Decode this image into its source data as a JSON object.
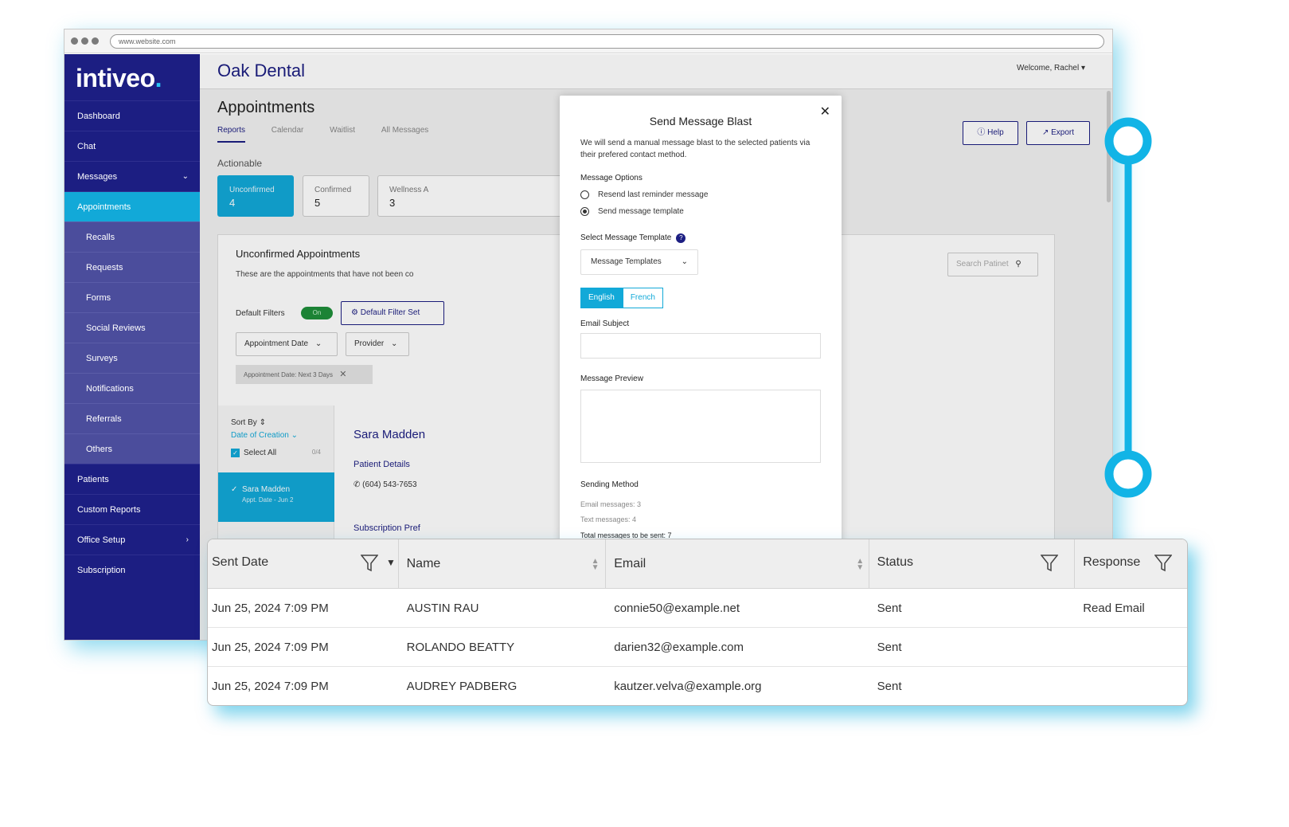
{
  "browser": {
    "url": "www.website.com"
  },
  "brand": {
    "logo_main": "intiveo",
    "logo_dot": ".",
    "accent": "#12a9d8",
    "primary": "#1c1e82"
  },
  "sidebar": {
    "items": [
      {
        "label": "Dashboard"
      },
      {
        "label": "Chat"
      },
      {
        "label": "Messages"
      },
      {
        "label": "Appointments"
      },
      {
        "label": "Recalls"
      },
      {
        "label": "Requests"
      },
      {
        "label": "Forms"
      },
      {
        "label": "Social Reviews"
      },
      {
        "label": "Surveys"
      },
      {
        "label": "Notifications"
      },
      {
        "label": "Referrals"
      },
      {
        "label": "Others"
      },
      {
        "label": "Patients"
      },
      {
        "label": "Custom Reports"
      },
      {
        "label": "Office Setup"
      },
      {
        "label": "Subscription"
      }
    ]
  },
  "header": {
    "org": "Oak Dental",
    "welcome": "Welcome, Rachel"
  },
  "page": {
    "title": "Appointments",
    "tabs": [
      "Reports",
      "Calendar",
      "Waitlist",
      "All Messages"
    ],
    "help_label": "Help",
    "export_label": "Export",
    "section_label": "Actionable",
    "cards": [
      {
        "label": "Unconfirmed",
        "value": "4"
      },
      {
        "label": "Confirmed",
        "value": "5"
      },
      {
        "label": "Wellness A",
        "value": "3"
      }
    ]
  },
  "panel": {
    "title": "Unconfirmed Appointments",
    "desc": "These are the appointments that have not been co",
    "default_filters": "Default Filters",
    "toggle": "On",
    "filter_settings": "Default Filter Set",
    "filter_date": "Appointment Date",
    "filter_provider": "Provider",
    "chip": "Appointment Date: Next 3 Days",
    "search_placeholder": "Search Patinet",
    "sort_by": "Sort By",
    "sort_value": "Date of Creation",
    "select_all": "Select All",
    "count": "0/4",
    "patient_item": {
      "name": "Sara Madden",
      "sub": "Appt. Date - Jun 2"
    },
    "patient_name": "Sara Madden",
    "patient_details": "Patient Details",
    "phone": "(604) 543-7653",
    "subscription": "Subscription Pref"
  },
  "modal": {
    "title": "Send Message Blast",
    "desc": "We will send a manual message blast to the selected patients via their prefered contact method.",
    "options_label": "Message Options",
    "option1": "Resend last reminder message",
    "option2": "Send message template",
    "template_label": "Select Message Template",
    "template_select": "Message Templates",
    "lang_english": "English",
    "lang_french": "French",
    "subject_label": "Email Subject",
    "preview_label": "Message Preview",
    "method_label": "Sending Method",
    "email_count": "Email messages: 3",
    "text_count": "Text messages: 4",
    "total": "Total messages to be sent: 7"
  },
  "table": {
    "columns": [
      "Sent Date",
      "Name",
      "Email",
      "Status",
      "Response"
    ],
    "rows": [
      {
        "date": "Jun 25, 2024 7:09 PM",
        "name": "AUSTIN RAU",
        "email": "connie50@example.net",
        "status": "Sent",
        "response": "Read Email"
      },
      {
        "date": "Jun 25, 2024 7:09 PM",
        "name": "ROLANDO BEATTY",
        "email": "darien32@example.com",
        "status": "Sent",
        "response": ""
      },
      {
        "date": "Jun 25, 2024 7:09 PM",
        "name": "AUDREY PADBERG",
        "email": "kautzer.velva@example.org",
        "status": "Sent",
        "response": ""
      }
    ]
  }
}
